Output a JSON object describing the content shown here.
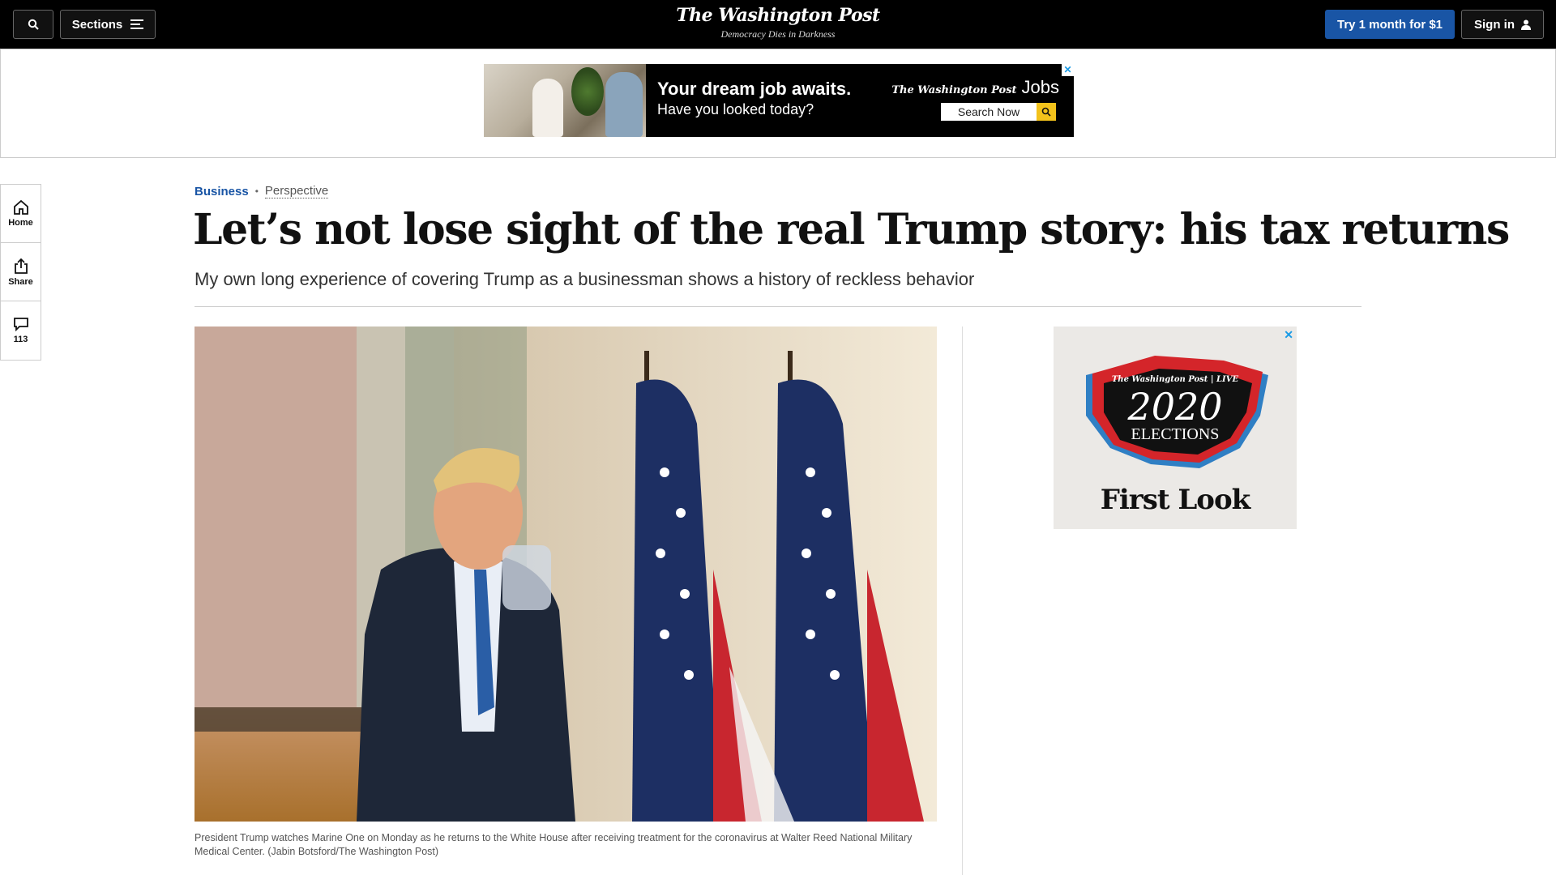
{
  "nav": {
    "sections_label": "Sections",
    "logo_text": "The Washington Post",
    "tagline": "Democracy Dies in Darkness",
    "try_label": "Try 1 month for $1",
    "signin_label": "Sign in"
  },
  "top_ad": {
    "headline": "Your dream job awaits.",
    "subline": "Have you looked today?",
    "brand": "The Washington Post",
    "brand_product": "Jobs",
    "search_label": "Search Now",
    "close_glyph": "✕"
  },
  "left_rail": {
    "home_label": "Home",
    "share_label": "Share",
    "comments_count": "113"
  },
  "article": {
    "section": "Business",
    "label": "Perspective",
    "headline": "Let’s not lose sight of the real Trump story: his tax returns",
    "dek": "My own long experience of covering Trump as a businessman shows a history of reckless behavior",
    "caption": "President Trump watches Marine One on Monday as he returns to the White House after receiving treatment for the coronavirus at Walter Reed National Military Medical Center. (Jabin Botsford/The Washington Post)"
  },
  "side_ad": {
    "brand": "The Washington Post | LIVE",
    "year": "2020",
    "title": "ELECTIONS",
    "cta": "First Look",
    "close_glyph": "✕"
  },
  "colors": {
    "accent": "#1955a5",
    "nav_bg": "#000000",
    "section_link": "#1955a5"
  }
}
